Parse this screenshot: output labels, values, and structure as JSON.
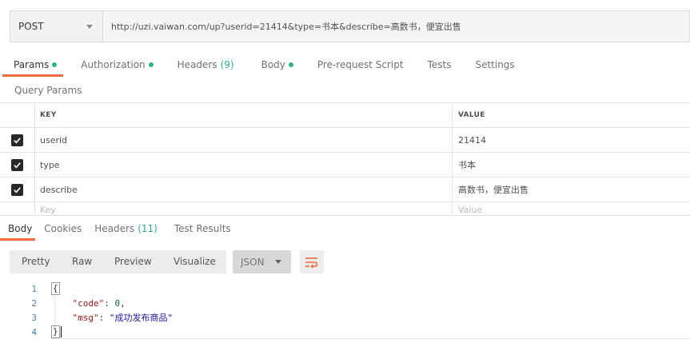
{
  "request": {
    "method": "POST",
    "url": "http://uzi.vaiwan.com/up?userid=21414&type=书本&describe=高数书，便宜出售"
  },
  "request_tabs": [
    {
      "label": "Params",
      "dot": true,
      "active": true
    },
    {
      "label": "Authorization",
      "dot": true
    },
    {
      "label": "Headers",
      "count": "(9)"
    },
    {
      "label": "Body",
      "dot": true
    },
    {
      "label": "Pre-request Script"
    },
    {
      "label": "Tests"
    },
    {
      "label": "Settings"
    }
  ],
  "query_params": {
    "section_label": "Query Params",
    "headers": {
      "key": "KEY",
      "value": "VALUE"
    },
    "rows": [
      {
        "key": "userid",
        "value": "21414",
        "checked": true
      },
      {
        "key": "type",
        "value": "书本",
        "checked": true
      },
      {
        "key": "describe",
        "value": "高数书，便宜出售",
        "checked": true
      }
    ],
    "placeholder": {
      "key": "Key",
      "value": "Value"
    }
  },
  "response_tabs": [
    {
      "label": "Body",
      "active": true
    },
    {
      "label": "Cookies"
    },
    {
      "label": "Headers",
      "count": "(11)"
    },
    {
      "label": "Test Results"
    }
  ],
  "viewer": {
    "modes": [
      "Pretty",
      "Raw",
      "Preview",
      "Visualize"
    ],
    "format": "JSON"
  },
  "response_body": {
    "line_numbers": [
      "1",
      "2",
      "3",
      "4"
    ],
    "open_brace": "{",
    "close_brace": "}",
    "code_key": "\"code\"",
    "code_value": "0",
    "msg_key": "\"msg\"",
    "msg_value": "\"成功发布商品\""
  },
  "colors": {
    "accent": "#f26b3a",
    "status_dot": "#26b47f"
  }
}
